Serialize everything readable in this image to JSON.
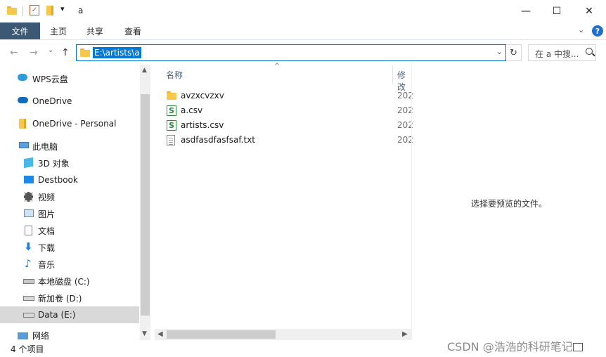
{
  "window": {
    "title": "a",
    "minimize": "—",
    "maximize": "☐",
    "close": "✕"
  },
  "ribbon": {
    "tabs": [
      "文件",
      "主页",
      "共享",
      "查看"
    ],
    "expand": "⌄",
    "help": "?"
  },
  "nav": {
    "back": "←",
    "forward": "→",
    "recent": "⌄",
    "up": "↑",
    "address": "E:\\artists\\a",
    "search_placeholder": "在 a 中搜..."
  },
  "sidebar": {
    "items": [
      {
        "label": "WPS云盘",
        "icon": "cloud-icon"
      },
      {
        "label": "OneDrive",
        "icon": "onedrive-icon"
      },
      {
        "label": "OneDrive - Personal",
        "icon": "folder-icon"
      },
      {
        "label": "此电脑",
        "icon": "computer-icon"
      },
      {
        "label": "3D 对象",
        "icon": "3d-objects-icon"
      },
      {
        "label": "Destbook",
        "icon": "desktop-icon"
      },
      {
        "label": "视频",
        "icon": "video-icon"
      },
      {
        "label": "图片",
        "icon": "pictures-icon"
      },
      {
        "label": "文档",
        "icon": "documents-icon"
      },
      {
        "label": "下载",
        "icon": "download-icon"
      },
      {
        "label": "音乐",
        "icon": "music-icon"
      },
      {
        "label": "本地磁盘 (C:)",
        "icon": "drive-icon"
      },
      {
        "label": "新加卷 (D:)",
        "icon": "drive-icon"
      },
      {
        "label": "Data (E:)",
        "icon": "drive-icon",
        "selected": true
      },
      {
        "label": "网络",
        "icon": "network-icon"
      }
    ]
  },
  "filelist": {
    "columns": {
      "name": "名称",
      "modified": "修改"
    },
    "files": [
      {
        "name": "avzxcvzxv",
        "type": "folder",
        "date": "202"
      },
      {
        "name": "a.csv",
        "type": "csv",
        "date": "202"
      },
      {
        "name": "artists.csv",
        "type": "csv",
        "date": "202"
      },
      {
        "name": "asdfasdfasfsaf.txt",
        "type": "txt",
        "date": "202"
      }
    ]
  },
  "preview": {
    "message": "选择要预览的文件。"
  },
  "status": {
    "count": "4 个项目",
    "watermark": "CSDN @浩浩的科研笔记"
  }
}
